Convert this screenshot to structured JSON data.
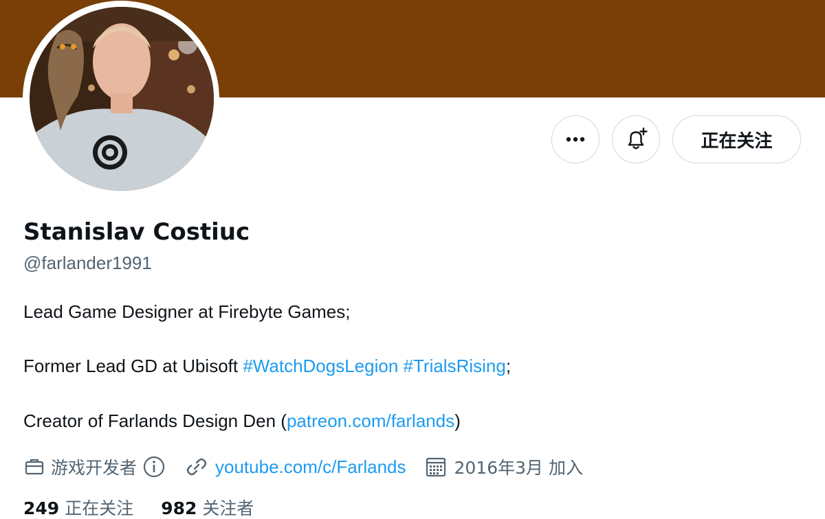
{
  "profile": {
    "name": "Stanislav Costiuc",
    "handle": "@farlander1991",
    "banner_color": "#7a3f06"
  },
  "actions": {
    "more_icon": "more-horizontal-icon",
    "notify_icon": "bell-plus-icon",
    "follow_label": "正在关注"
  },
  "bio": {
    "line1": "Lead Game Designer at Firebyte Games;",
    "line2_prefix": "Former Lead GD at Ubisoft ",
    "line2_tag1": "#WatchDogsLegion",
    "line2_tag2": "#TrialsRising",
    "line2_suffix": ";",
    "line3_prefix": "Creator of Farlands Design Den (",
    "line3_link": "patreon.com/farlands",
    "line3_suffix": ")"
  },
  "meta": {
    "category": "游戏开发者",
    "category_icon": "briefcase-icon",
    "info_icon": "info-icon",
    "website": "youtube.com/c/Farlands",
    "website_icon": "link-icon",
    "joined": "2016年3月 加入",
    "joined_icon": "calendar-icon"
  },
  "stats": {
    "following_count": "249",
    "following_label": "正在关注",
    "followers_count": "982",
    "followers_label": "关注者"
  },
  "colors": {
    "link": "#1d9bf0",
    "secondary_text": "#536471",
    "primary_text": "#0f1419"
  }
}
